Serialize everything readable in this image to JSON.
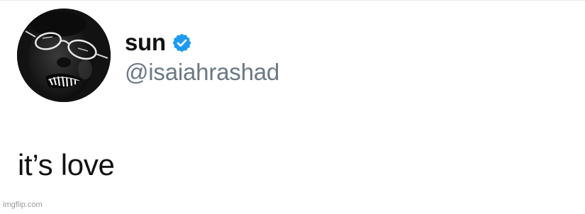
{
  "tweet": {
    "display_name": "sun",
    "verified": true,
    "handle": "@isaiahrashad",
    "text": "it’s love"
  },
  "watermark": {
    "text": "imgflip.com"
  },
  "icons": {
    "verified": "verified-badge-icon",
    "avatar": "profile-avatar"
  },
  "colors": {
    "verified_badge": "#1d9bf0",
    "handle": "#6b7884",
    "name": "#111111"
  }
}
